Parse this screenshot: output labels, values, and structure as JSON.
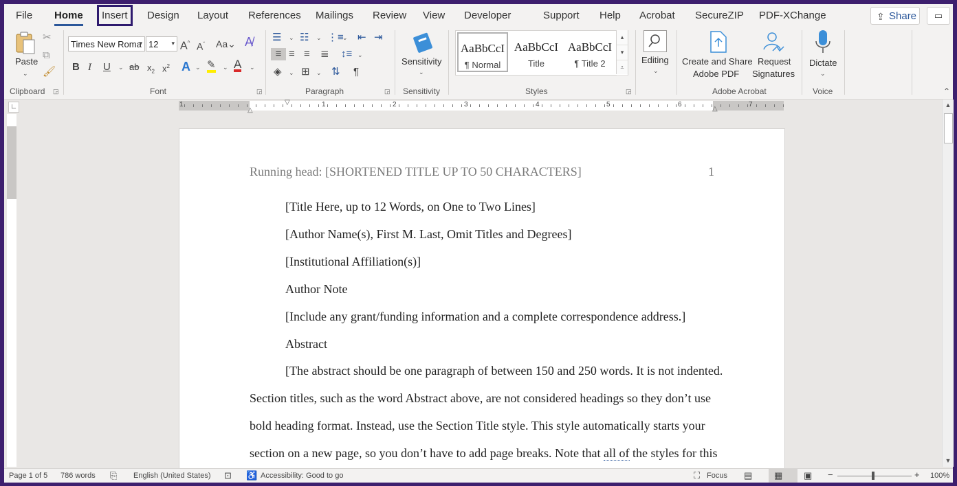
{
  "tabs": [
    "File",
    "Home",
    "Insert",
    "Design",
    "Layout",
    "References",
    "Mailings",
    "Review",
    "View",
    "Developer",
    "Support",
    "Help",
    "Acrobat",
    "SecureZIP",
    "PDF-XChange"
  ],
  "active_tab": "Home",
  "highlighted_tab": "Insert",
  "share_label": "Share",
  "clipboard": {
    "paste_label": "Paste",
    "group_label": "Clipboard"
  },
  "font": {
    "name": "Times New Roma",
    "size": "12",
    "group_label": "Font",
    "change_case": "Aa"
  },
  "paragraph": {
    "group_label": "Paragraph"
  },
  "sensitivity": {
    "label": "Sensitivity",
    "group_label": "Sensitivity"
  },
  "styles": {
    "group_label": "Styles",
    "items": [
      {
        "sample": "AaBbCcI",
        "name": "¶ Normal"
      },
      {
        "sample": "AaBbCcI",
        "name": "Title"
      },
      {
        "sample": "AaBbCcI",
        "name": "¶ Title 2"
      }
    ]
  },
  "editing": {
    "label": "Editing"
  },
  "acrobat": {
    "create_label_1": "Create and Share",
    "create_label_2": "Adobe PDF",
    "request_label_1": "Request",
    "request_label_2": "Signatures",
    "group_label": "Adobe Acrobat"
  },
  "voice": {
    "dictate_label": "Dictate",
    "group_label": "Voice"
  },
  "ruler_numbers": [
    "1",
    "1",
    "2",
    "3",
    "4",
    "5",
    "6",
    "7"
  ],
  "document": {
    "header": "Running head: [SHORTENED TITLE UP TO 50 CHARACTERS]",
    "page_number": "1",
    "lines": [
      "[Title Here, up to 12 Words, on One to Two Lines]",
      "[Author Name(s), First M. Last, Omit Titles and Degrees]",
      "[Institutional Affiliation(s)]",
      "Author Note",
      "[Include any grant/funding information and a complete correspondence address.]",
      "Abstract",
      "[The abstract should be one paragraph of between 150 and 250 words.  It is not indented.",
      "Section titles, such as the word Abstract above, are not considered headings so they don’t use",
      "bold heading format.  Instead, use the Section Title style.  This style automatically starts your",
      "section on a new page, so you don’t have to add page breaks.  Note that",
      "all of",
      "the styles for this"
    ]
  },
  "status": {
    "page": "Page 1 of 5",
    "words": "786 words",
    "language": "English (United States)",
    "accessibility": "Accessibility: Good to go",
    "focus": "Focus",
    "zoom": "100%"
  }
}
